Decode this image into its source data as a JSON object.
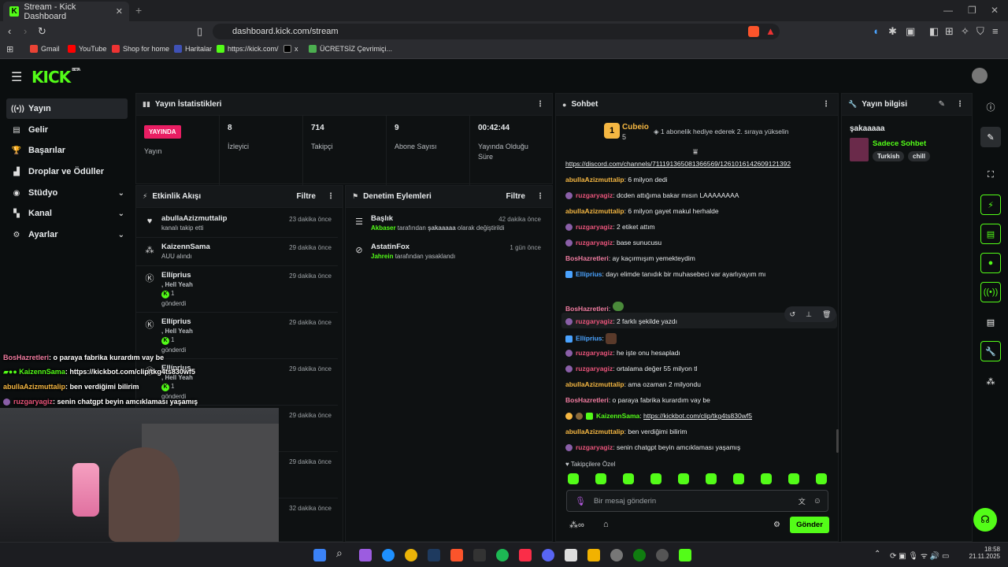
{
  "browser": {
    "tab_title": "Stream - Kick Dashboard",
    "url": "dashboard.kick.com/stream",
    "bookmarks": [
      "Gmail",
      "YouTube",
      "Shop for home",
      "Haritalar",
      "https://kick.com/",
      "x",
      "ÜCRETSİZ Çevrimiçi..."
    ]
  },
  "sidebar": {
    "items": [
      {
        "label": "Yayın",
        "icon": "broadcast-icon"
      },
      {
        "label": "Gelir",
        "icon": "revenue-icon"
      },
      {
        "label": "Başarılar",
        "icon": "trophy-icon"
      },
      {
        "label": "Droplar ve Ödüller",
        "icon": "gift-icon"
      },
      {
        "label": "Stüdyo",
        "icon": "studio-icon"
      },
      {
        "label": "Kanal",
        "icon": "channel-icon"
      },
      {
        "label": "Ayarlar",
        "icon": "gear-icon"
      }
    ]
  },
  "stats": {
    "title": "Yayın İstatistikleri",
    "live_badge": "YAYINDA",
    "items": [
      {
        "value": "",
        "label": "Yayın"
      },
      {
        "value": "8",
        "label": "İzleyici"
      },
      {
        "value": "714",
        "label": "Takipçi"
      },
      {
        "value": "9",
        "label": "Abone Sayısı"
      },
      {
        "value": "00:42:44",
        "label": "Yayında Olduğu Süre"
      }
    ]
  },
  "activity": {
    "title": "Etkinlik Akışı",
    "filter": "Filtre",
    "items": [
      {
        "name": "abullaAzizmuttalip",
        "sub": "kanalı takip etti",
        "time": "23 dakika önce"
      },
      {
        "name": "KaizennSama",
        "sub": "AUU alındı",
        "time": "29 dakika önce"
      },
      {
        "name": "Ellíprius",
        "extra": ", Hell Yeah",
        "count": "1",
        "sub": "gönderdi",
        "time": "29 dakika önce"
      },
      {
        "name": "Ellíprius",
        "extra": ", Hell Yeah",
        "count": "1",
        "sub": "gönderdi",
        "time": "29 dakika önce"
      },
      {
        "name": "Ellíprius",
        "extra": ", Hell Yeah",
        "count": "1",
        "sub": "gönderdi",
        "time": "29 dakika önce"
      },
      {
        "time": "29 dakika önce"
      },
      {
        "time": "29 dakika önce"
      },
      {
        "time": "32 dakika önce"
      }
    ]
  },
  "moderation": {
    "title": "Denetim Eylemleri",
    "filter": "Filtre",
    "items": [
      {
        "name": "Başlık",
        "actor": "Akbaser",
        "text1": " tarafından ",
        "target": "şakaaaaa",
        "text2": " olarak değiştirildi",
        "time": "42 dakika önce"
      },
      {
        "name": "AstatinFox",
        "actor": "Jahrein",
        "text1": " tarafından yasaklandı",
        "target": "",
        "text2": "",
        "time": "1 gün önce"
      }
    ]
  },
  "chat": {
    "title": "Sohbet",
    "pinned_user": "Cubeio",
    "pinned_count": "5",
    "pinned_rank": "1",
    "pinned_text": "1 abonelik hediye ederek 2. sıraya yükselin",
    "messages": [
      {
        "user": "",
        "text": "https://discord.com/channels/711191365081366569/1261016142609121392",
        "color": "link"
      },
      {
        "user": "abullaAzizmuttalip",
        "text": ": 6 milyon dedi",
        "color": "orange"
      },
      {
        "user": "ruzgaryagiz",
        "text": ": dcden attığıma bakar mısın LAAAAAAAA",
        "color": "pink"
      },
      {
        "user": "abullaAzizmuttalip",
        "text": ": 6 milyon gayet makul herhalde",
        "color": "orange"
      },
      {
        "user": "ruzgaryagiz",
        "text": ": 2 etiket attım",
        "color": "pink"
      },
      {
        "user": "ruzgaryagiz",
        "text": ": base sunucusu",
        "color": "pink"
      },
      {
        "user": "BosHazretleri",
        "text": ": ay kaçırmışım yemekteydim",
        "color": "pink2"
      },
      {
        "user": "Ellíprius",
        "text": ": dayı elimde tanıdık bir muhasebeci var ayarlıyayım mı",
        "color": "blue"
      },
      {
        "user": "BosHazretleri",
        "text": ":",
        "color": "pink2"
      },
      {
        "user": "ruzgaryagiz",
        "text": ": 2 farklı şekilde yazdı",
        "color": "pink"
      },
      {
        "user": "Ellíprius",
        "text": ":",
        "color": "blue"
      },
      {
        "user": "ruzgaryagiz",
        "text": ": he işte onu hesapladı",
        "color": "pink"
      },
      {
        "user": "ruzgaryagiz",
        "text": ": ortalama değer 55 milyon tl",
        "color": "pink"
      },
      {
        "user": "abullaAzizmuttalip",
        "text": ": ama ozaman 2 milyondu",
        "color": "orange"
      },
      {
        "user": "BosHazretleri",
        "text": ": o paraya fabrika kurardım vay be",
        "color": "pink2"
      },
      {
        "user": "KaizennSama",
        "text": ": ",
        "link": "https://kickbot.com/clip/tkg4ts830wf5",
        "color": "green"
      },
      {
        "user": "abullaAzizmuttalip",
        "text": ": ben verdiğimi bilirim",
        "color": "orange"
      },
      {
        "user": "ruzgaryagiz",
        "text": ": senin chatgpt beyin amcıklaması yaşamış",
        "color": "pink"
      }
    ],
    "followers_only": "Takipçilere Özel",
    "input_placeholder": "Bir mesaj gönderin",
    "send_label": "Gönder"
  },
  "stream_info": {
    "title": "Yayın bilgisi",
    "stream_title": "şakaaaaa",
    "category": "Sadece Sohbet",
    "tags": [
      "Turkish",
      "chill"
    ]
  },
  "overlay": {
    "lines": [
      {
        "user": "BosHazretleri",
        "text": ": o paraya fabrika kurardım vay be"
      },
      {
        "user": "KaizennSama",
        "text": ": https://kickbot.com/clip/tkg4ts830wf5"
      },
      {
        "user": "abullaAzizmuttalip",
        "text": ": ben verdiğimi bilirim"
      },
      {
        "user": "ruzgaryagiz",
        "text": ": senin chatgpt beyin amcıklaması yaşamış"
      }
    ]
  },
  "taskbar": {
    "time": "18:58",
    "date": "21.11.2025"
  }
}
